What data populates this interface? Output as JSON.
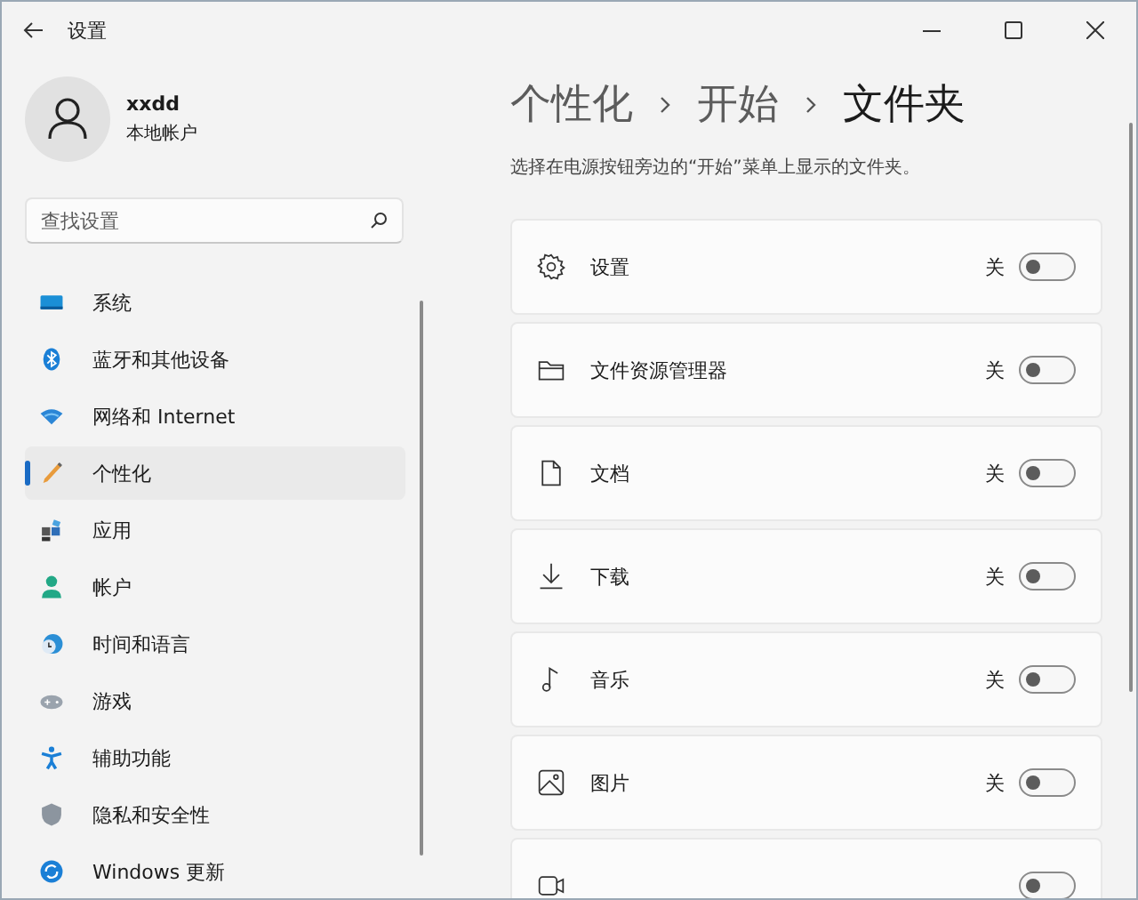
{
  "window": {
    "title": "设置"
  },
  "user": {
    "name": "xxdd",
    "account_type": "本地帐户"
  },
  "search": {
    "placeholder": "查找设置"
  },
  "nav": [
    {
      "label": "系统",
      "selected": false
    },
    {
      "label": "蓝牙和其他设备",
      "selected": false
    },
    {
      "label": "网络和 Internet",
      "selected": false
    },
    {
      "label": "个性化",
      "selected": true
    },
    {
      "label": "应用",
      "selected": false
    },
    {
      "label": "帐户",
      "selected": false
    },
    {
      "label": "时间和语言",
      "selected": false
    },
    {
      "label": "游戏",
      "selected": false
    },
    {
      "label": "辅助功能",
      "selected": false
    },
    {
      "label": "隐私和安全性",
      "selected": false
    },
    {
      "label": "Windows 更新",
      "selected": false
    }
  ],
  "breadcrumb": [
    "个性化",
    "开始",
    "文件夹"
  ],
  "description": "选择在电源按钮旁边的“开始”菜单上显示的文件夹。",
  "folders": [
    {
      "label": "设置",
      "state_label": "关",
      "on": false
    },
    {
      "label": "文件资源管理器",
      "state_label": "关",
      "on": false
    },
    {
      "label": "文档",
      "state_label": "关",
      "on": false
    },
    {
      "label": "下载",
      "state_label": "关",
      "on": false
    },
    {
      "label": "音乐",
      "state_label": "关",
      "on": false
    },
    {
      "label": "图片",
      "state_label": "关",
      "on": false
    },
    {
      "on": false
    }
  ]
}
